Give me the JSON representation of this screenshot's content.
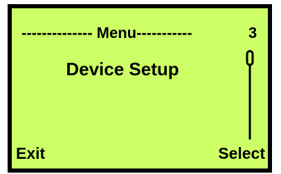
{
  "display": {
    "background_color": "#ccff66",
    "border_color": "#000000",
    "text_color": "#000000"
  },
  "header": {
    "title": "-------------- Menu-----------",
    "page_number": "3"
  },
  "menu": {
    "current_item": "Device Setup",
    "scroll_position": 0
  },
  "softkeys": {
    "left_label": "Exit",
    "right_label": "Select"
  }
}
